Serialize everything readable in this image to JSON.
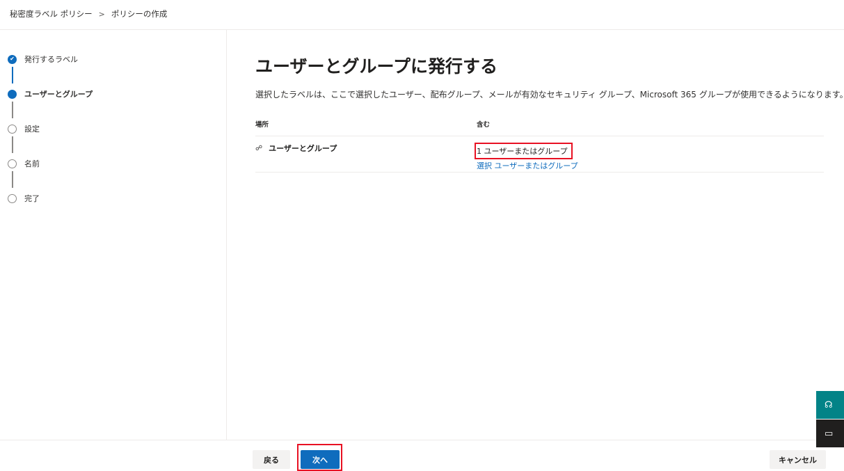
{
  "breadcrumb": {
    "items": [
      "秘密度ラベル ポリシー",
      "ポリシーの作成"
    ],
    "separator": ">"
  },
  "steps": [
    {
      "label": "発行するラベル",
      "state": "done"
    },
    {
      "label": "ユーザーとグループ",
      "state": "current"
    },
    {
      "label": "設定",
      "state": "pending"
    },
    {
      "label": "名前",
      "state": "pending"
    },
    {
      "label": "完了",
      "state": "pending"
    }
  ],
  "main": {
    "heading": "ユーザーとグループに発行する",
    "description": "選択したラベルは、ここで選択したユーザー、配布グループ、メールが有効なセキュリティ グループ、Microsoft 365 グループが使用できるようになります。",
    "table": {
      "col_location": "場所",
      "col_include": "含む",
      "row": {
        "location": "ユーザーとグループ",
        "include_count": "1 ユーザーまたはグループ",
        "select_link": "選択 ユーザーまたはグループ"
      }
    }
  },
  "footer": {
    "back_label": "戻る",
    "next_label": "次へ",
    "cancel_label": "キャンセル"
  },
  "icons": {
    "check": "✔",
    "users": "☍",
    "help": "☊",
    "feedback": "▭"
  },
  "colors": {
    "accent": "#0f6cbd",
    "highlight": "#e81123",
    "help_tab": "#038387"
  }
}
